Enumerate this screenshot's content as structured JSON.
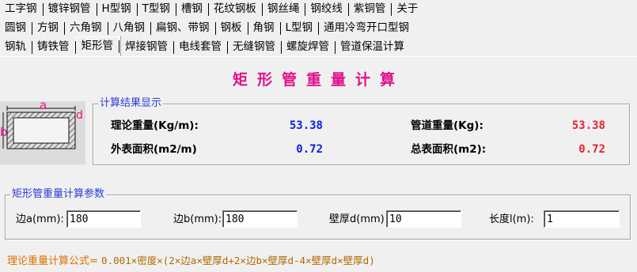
{
  "tabs": {
    "row1": [
      "工字钢",
      "镀锌钢管",
      "H型钢",
      "T型钢",
      "槽钢",
      "花纹钢板",
      "钢丝绳",
      "钢绞线",
      "紫铜管",
      "关于"
    ],
    "row2": [
      "圆钢",
      "方钢",
      "六角钢",
      "八角钢",
      "扁钢、带钢",
      "钢板",
      "角钢",
      "L型钢",
      "通用冷弯开口型钢"
    ],
    "row3": [
      "钢轨",
      "铸铁管",
      "矩形管",
      "焊接钢管",
      "电线套管",
      "无缝钢管",
      "螺旋焊管",
      "管道保温计算"
    ],
    "selected": "矩形管"
  },
  "title": "矩形管重量计算",
  "diagram": {
    "label_a": "a",
    "label_b": "b",
    "label_d": "d"
  },
  "results": {
    "legend": "计算结果显示",
    "theory_weight_label": "理论重量(Kg/m):",
    "theory_weight_value": "53.38",
    "pipe_weight_label": "管道重量(Kg):",
    "pipe_weight_value": "53.38",
    "outer_area_label": "外表面积(m2/m)",
    "outer_area_value": "0.72",
    "total_area_label": "总表面积(m2):",
    "total_area_value": "0.72"
  },
  "params": {
    "legend": "矩形管重量计算参数",
    "side_a_label": "边a(mm):",
    "side_a_value": "180",
    "side_b_label": "边b(mm):",
    "side_b_value": "180",
    "wall_label": "壁厚d(mm)",
    "wall_value": "10",
    "length_label": "长度l(m):",
    "length_value": "1"
  },
  "formula": {
    "label": "理论重量计算公式=",
    "text": "0.001×密度×(2×边a×壁厚d+2×边b×壁厚d-4×壁厚d×壁厚d)"
  },
  "colors": {
    "title": "#e0128a",
    "legend": "#2a3bd8",
    "value_blue": "#0b1ee0",
    "value_red": "#ea1f2f",
    "formula": "#e07000"
  }
}
